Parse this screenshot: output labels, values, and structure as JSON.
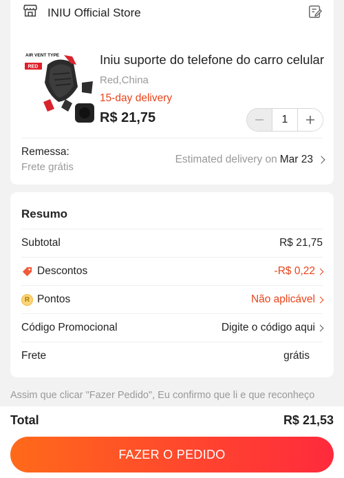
{
  "store": {
    "name": "INIU Official Store",
    "icon": "store-icon",
    "edit_icon": "edit-note-icon"
  },
  "product": {
    "title": "Iniu suporte do telefone do carro celular",
    "variant": "Red,China",
    "delivery": "15-day delivery",
    "price": "R$ 21,75",
    "quantity": "1",
    "thumb_badge_top": "AIR VENT TYPE",
    "thumb_badge_bottom": "RED"
  },
  "shipping": {
    "label": "Remessa:",
    "value": "Frete grátis",
    "estimate_prefix": "Estimated delivery on",
    "estimate_date": "Mar 23"
  },
  "summary": {
    "title": "Resumo",
    "rows": [
      {
        "label": "Subtotal",
        "value": "R$ 21,75"
      },
      {
        "label": "Descontos",
        "value": "-R$ 0,22"
      },
      {
        "label": "Pontos",
        "value": "Não aplicável"
      },
      {
        "label": "Código Promocional",
        "value": "Digite o código aqui"
      },
      {
        "label": "Frete",
        "value": "grátis"
      }
    ]
  },
  "legal": "Assim que clicar \"Fazer Pedido\", Eu confirmo que li e que reconheço",
  "footer": {
    "total_label": "Total",
    "total_value": "R$ 21,53",
    "button_label": "FAZER O PEDIDO"
  },
  "colors": {
    "accent": "#e8431b",
    "button_start": "#ff6a1a",
    "button_end": "#ff2a3d"
  }
}
